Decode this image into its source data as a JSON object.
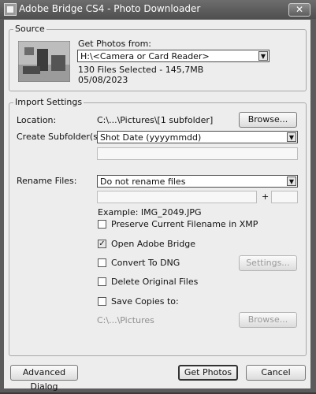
{
  "window": {
    "title": "Adobe Bridge CS4 - Photo Downloader",
    "close_glyph": "✕"
  },
  "source": {
    "group_label": "Source",
    "get_photos_label": "Get Photos from:",
    "device_value": "H:\\<Camera or Card Reader>",
    "files_selected": "130 Files Selected - 145,7MB",
    "date": "05/08/2023"
  },
  "import": {
    "group_label": "Import Settings",
    "location_label": "Location:",
    "location_value": "C:\\...\\Pictures\\[1 subfolder]",
    "browse_label": "Browse...",
    "subfolder_label": "Create Subfolder(s):",
    "subfolder_value": "Shot Date (yyyymmdd)",
    "rename_label": "Rename Files:",
    "rename_value": "Do not rename files",
    "plus": "+",
    "example": "Example:  IMG_2049.JPG",
    "preserve_label": "Preserve Current Filename in XMP",
    "open_bridge_label": "Open Adobe Bridge",
    "open_bridge_checked": true,
    "convert_label": "Convert To DNG",
    "settings_label": "Settings...",
    "delete_label": "Delete Original Files",
    "save_copies_label": "Save Copies to:",
    "save_copies_path": "C:\\...\\Pictures",
    "browse2_label": "Browse..."
  },
  "footer": {
    "advanced_label": "Advanced Dialog",
    "get_photos_button": "Get Photos",
    "cancel_label": "Cancel"
  },
  "colors": {
    "window_frame": "#5b5b5b",
    "dialog_bg": "#ededed"
  },
  "icons": {
    "check": "✓",
    "arrow": "▼"
  }
}
